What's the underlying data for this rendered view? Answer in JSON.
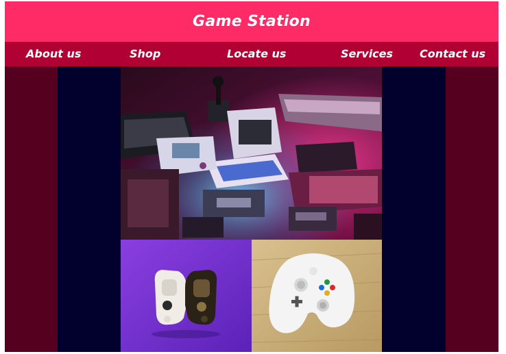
{
  "header": {
    "title": "Game Station"
  },
  "nav": {
    "items": [
      {
        "label": "About us"
      },
      {
        "label": "Shop"
      },
      {
        "label": "Locate us"
      },
      {
        "label": "Services"
      },
      {
        "label": "Contact us"
      }
    ]
  },
  "colors": {
    "header_bg": "#ff2b66",
    "nav_bg": "#b10034",
    "side_bg": "#55001f",
    "column_bg": "#02002d"
  },
  "images": {
    "main": "retro-computers-and-consoles",
    "bottom_left": "two-playstation-controllers",
    "bottom_right": "xbox-controller"
  }
}
